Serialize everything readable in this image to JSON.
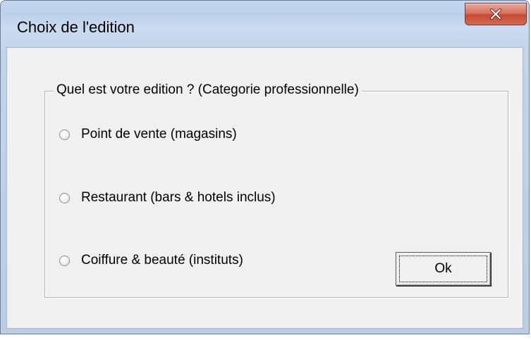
{
  "window": {
    "title": "Choix de l'edition"
  },
  "group": {
    "legend": "Quel est votre edition ? (Categorie professionnelle)"
  },
  "options": [
    {
      "label": "Point de vente (magasins)",
      "selected": false
    },
    {
      "label": "Restaurant (bars & hotels inclus)",
      "selected": false
    },
    {
      "label": "Coiffure & beauté (instituts)",
      "selected": false
    }
  ],
  "buttons": {
    "ok_label": "Ok"
  },
  "icons": {
    "close": "close-icon"
  },
  "colors": {
    "close_button": "#c74b35",
    "titlebar": "#c4d7ee",
    "client_background": "#f0f0f0"
  }
}
